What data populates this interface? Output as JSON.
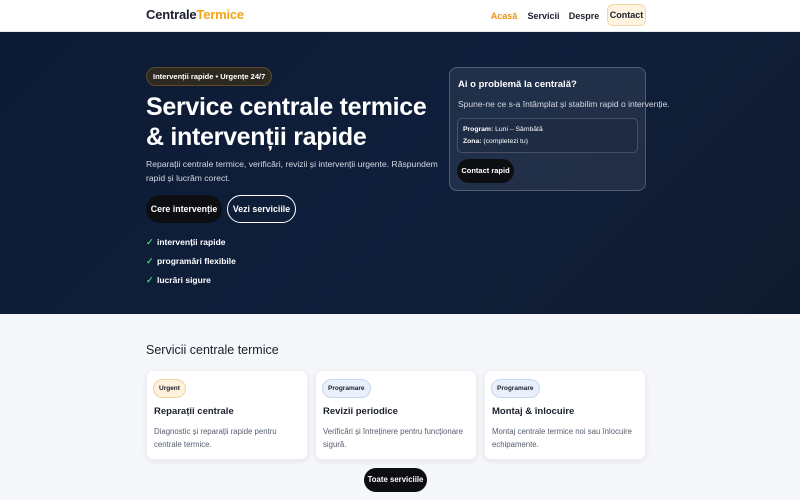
{
  "header": {
    "logo_part1": "Centrale",
    "logo_part2": "Termice",
    "nav": [
      {
        "label": "Acasă"
      },
      {
        "label": "Servicii"
      },
      {
        "label": "Despre"
      },
      {
        "label": "Contact"
      }
    ]
  },
  "hero": {
    "badge": "Intervenții rapide • Urgențe 24/7",
    "title": "Service centrale termice & intervenții rapide",
    "subtitle": "Reparații centrale termice, verificări, revizii și intervenții urgente. Răspundem rapid și lucrăm corect.",
    "primary_cta": "Cere intervenție",
    "secondary_cta": "Vezi serviciile",
    "checks": [
      "intervenții rapide",
      "programări flexibile",
      "lucrări sigure"
    ]
  },
  "quick_contact": {
    "title": "Ai o problemă la centrală?",
    "text": "Spune-ne ce s-a întâmplat și stabilim rapid o intervenție.",
    "program_label": "Program:",
    "program_value": "Luni – Sâmbătă",
    "zone_label": "Zona:",
    "zone_value": "(completezi tu)",
    "button": "Contact rapid"
  },
  "services": {
    "title": "Servicii centrale termice",
    "cards": [
      {
        "tag": "Urgent",
        "name": "Reparații centrale",
        "desc": "Diagnostic și reparații rapide pentru centrale termice."
      },
      {
        "tag": "Programare",
        "name": "Revizii periodice",
        "desc": "Verificări și întreținere pentru funcționare sigură."
      },
      {
        "tag": "Programare",
        "name": "Montaj & înlocuire",
        "desc": "Montaj centrale termice noi sau înlocuire echipamente."
      }
    ],
    "all_button": "Toate serviciile"
  },
  "colors": {
    "accent": "#f2a516",
    "hero_bg": "#0d1a33",
    "check": "#3ecf72",
    "button_dark": "#0c0e12"
  }
}
